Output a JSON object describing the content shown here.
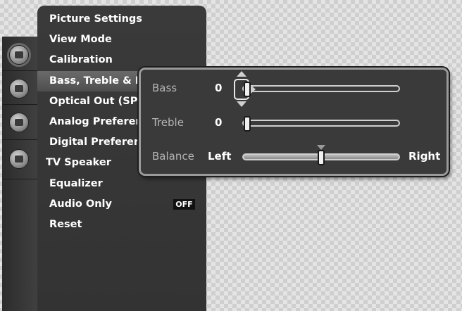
{
  "sidebar": {
    "icons": [
      {
        "name": "picture-icon",
        "active": true
      },
      {
        "name": "sound-icon",
        "active": false
      },
      {
        "name": "settings-icon",
        "active": false
      },
      {
        "name": "camera-icon",
        "active": false
      }
    ]
  },
  "menu": {
    "items": [
      {
        "label": "Picture Settings"
      },
      {
        "label": "View Mode"
      },
      {
        "label": "Calibration"
      },
      {
        "label": "Bass, Treble & Balance",
        "selected": true
      },
      {
        "label": "Optical Out (SPDIF)"
      },
      {
        "label": "Analog Preferences"
      },
      {
        "label": "Digital Preferences"
      },
      {
        "label": "TV Speaker"
      },
      {
        "label": "Equalizer"
      },
      {
        "label": "Audio Only",
        "value": "OFF"
      },
      {
        "label": "Reset"
      }
    ]
  },
  "popup": {
    "bass": {
      "label": "Bass",
      "value": "0",
      "level": 0
    },
    "treble": {
      "label": "Treble",
      "value": "0",
      "level": 0
    },
    "balance": {
      "label": "Balance",
      "left_label": "Left",
      "right_label": "Right",
      "level": 0.5
    }
  },
  "colors": {
    "accent": "#6a6a6a",
    "panel": "#3a3a3a",
    "popup_border": "#9a9a9a"
  }
}
